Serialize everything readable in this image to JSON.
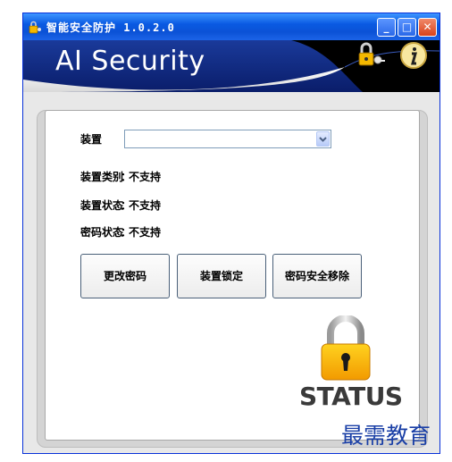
{
  "window": {
    "title": "智能安全防护 1.0.2.0",
    "banner_title": "AI Security"
  },
  "titlebar_buttons": {
    "minimize": "_",
    "maximize": "□",
    "close": "✕"
  },
  "device": {
    "label": "装置",
    "selected_value": ""
  },
  "info": {
    "type_label": "装置类别",
    "type_value": "不支持",
    "state_label": "装置状态",
    "state_value": "不支持",
    "password_label": "密码状态",
    "password_value": "不支持",
    "separator": "："
  },
  "buttons": {
    "change_password": "更改密码",
    "lock_device": "装置锁定",
    "remove_password": "密码安全移除"
  },
  "status": {
    "text": "STATUS",
    "icon": "padlock-icon"
  },
  "banner_icons": [
    "lock-key-icon",
    "info-icon"
  ],
  "watermark": "最需教育",
  "colors": {
    "titlebar": "#0a5ae2",
    "banner": "#000000",
    "lock": "#f5b800",
    "watermark": "#1a3fa6"
  }
}
